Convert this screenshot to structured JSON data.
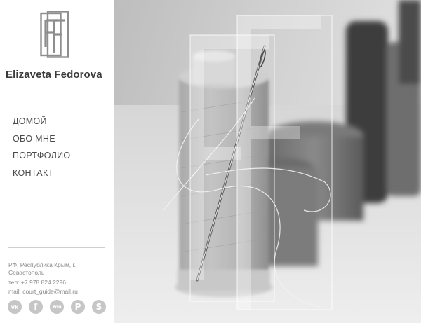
{
  "site": {
    "name": "Elizaveta Fedorova",
    "logo_icon": "ef-monogram-icon"
  },
  "nav": {
    "items": [
      {
        "label": "ДОМОЙ"
      },
      {
        "label": "ОБО МНЕ"
      },
      {
        "label": "ПОРТФОЛИО"
      },
      {
        "label": "КОНТАКТ"
      }
    ]
  },
  "contacts": {
    "address": "РФ, Республика Крым, г. Севастополь",
    "phone": "тел: +7 978 824 2296",
    "email": "mail: court_guide@mail.ru"
  },
  "socials": [
    {
      "icon": "vk-icon",
      "glyph": "vk"
    },
    {
      "icon": "facebook-icon",
      "glyph": "f"
    },
    {
      "icon": "youtube-icon",
      "glyph": "You"
    },
    {
      "icon": "pinterest-icon",
      "glyph": "P"
    },
    {
      "icon": "skype-icon",
      "glyph": "S"
    }
  ],
  "hero": {
    "image_icon": "needle-and-thread-spools-photo-icon"
  },
  "colors": {
    "sidebar_bg": "#ffffff",
    "text": "#3a3a3a",
    "muted": "#8a8a8a",
    "social_bg": "#c6c6c6"
  }
}
